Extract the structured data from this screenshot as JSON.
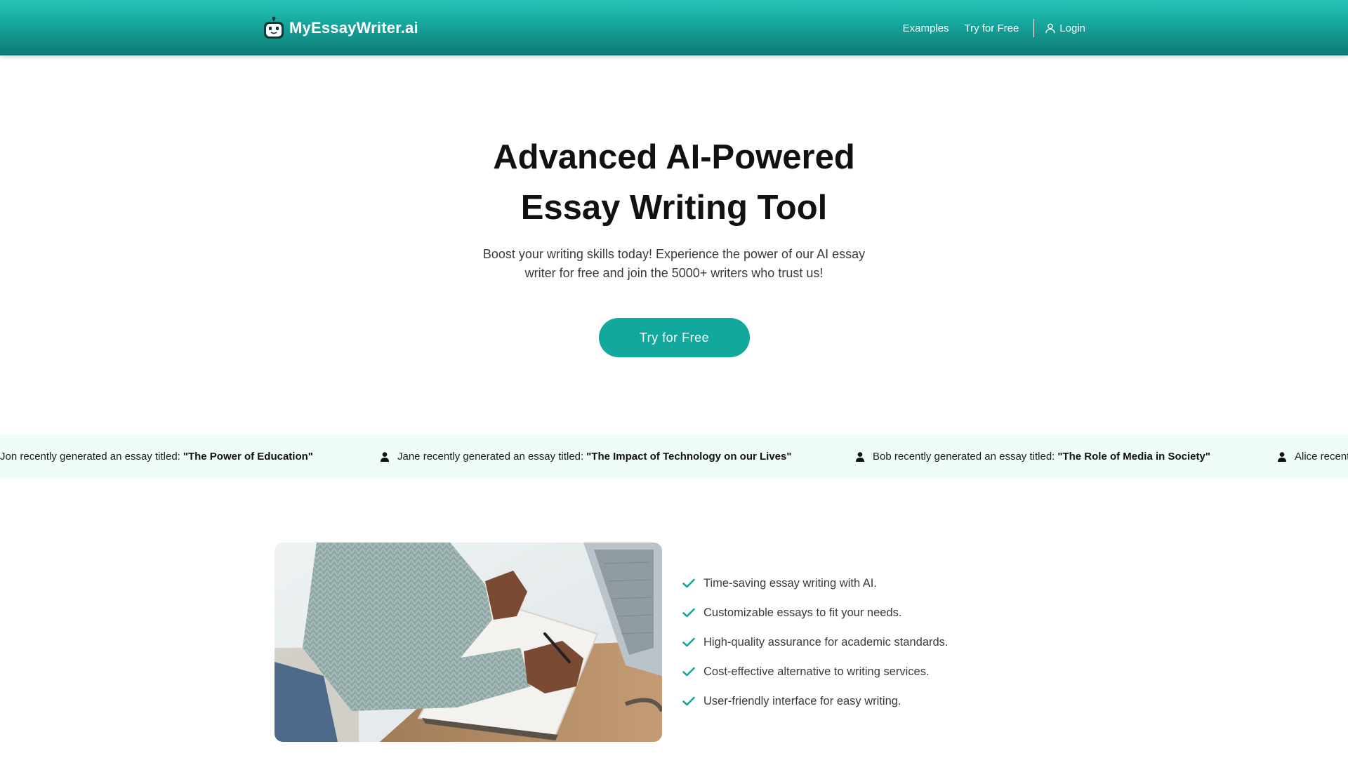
{
  "header": {
    "brand": "MyEssayWriter.ai",
    "nav": {
      "examples": "Examples",
      "try_free": "Try for Free",
      "login": "Login"
    }
  },
  "hero": {
    "title_line1": "Advanced AI-Powered",
    "title_line2": "Essay Writing Tool",
    "subtitle_line1": "Boost your writing skills today! Experience the power of our AI essay",
    "subtitle_line2": "writer for free and join the 5000+ writers who trust us!",
    "cta": "Try for Free"
  },
  "ticker": {
    "items": [
      {
        "prefix": "Jon recently generated an essay titled:",
        "title": "\"The Power of Education\""
      },
      {
        "prefix": "Jane recently generated an essay titled:",
        "title": "\"The Impact of Technology on our Lives\""
      },
      {
        "prefix": "Bob recently generated an essay titled:",
        "title": "\"The Role of Media in Society\""
      },
      {
        "prefix": "Alice recent",
        "title": ""
      }
    ]
  },
  "features": {
    "items": [
      "Time-saving essay writing with AI.",
      "Customizable essays to fit your needs.",
      "High-quality assurance for academic standards.",
      "Cost-effective alternative to writing services.",
      "User-friendly interface for easy writing."
    ]
  },
  "colors": {
    "brand_teal": "#13a89e",
    "header_top": "#26c4b8",
    "header_bottom": "#0c7a74",
    "ticker_bg": "#effcfa",
    "check_color": "#13a89e"
  },
  "icons": {
    "logo": "robot-icon",
    "login": "user-outline-icon",
    "ticker": "user-solid-icon",
    "feature": "check-icon"
  }
}
